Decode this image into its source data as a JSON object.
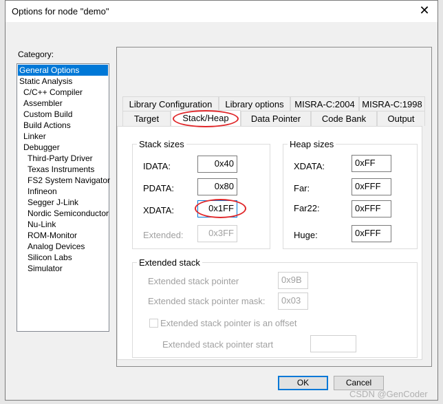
{
  "window": {
    "title": "Options for node \"demo\"",
    "close_icon": "close-icon"
  },
  "category": {
    "label": "Category:",
    "items": [
      {
        "label": "General Options",
        "indent": false,
        "selected": true
      },
      {
        "label": "Static Analysis",
        "indent": false
      },
      {
        "label": "C/C++ Compiler",
        "indent": true
      },
      {
        "label": "Assembler",
        "indent": true
      },
      {
        "label": "Custom Build",
        "indent": true
      },
      {
        "label": "Build Actions",
        "indent": true
      },
      {
        "label": "Linker",
        "indent": true
      },
      {
        "label": "Debugger",
        "indent": true
      },
      {
        "label": "Third-Party Driver",
        "indent": 2
      },
      {
        "label": "Texas Instruments",
        "indent": 2
      },
      {
        "label": "FS2 System Navigator",
        "indent": 2
      },
      {
        "label": "Infineon",
        "indent": 2
      },
      {
        "label": "Segger J-Link",
        "indent": 2
      },
      {
        "label": "Nordic Semiconductor",
        "indent": 2
      },
      {
        "label": "Nu-Link",
        "indent": 2
      },
      {
        "label": "ROM-Monitor",
        "indent": 2
      },
      {
        "label": "Analog Devices",
        "indent": 2
      },
      {
        "label": "Silicon Labs",
        "indent": 2
      },
      {
        "label": "Simulator",
        "indent": 2
      }
    ]
  },
  "tabs": {
    "row1": [
      "Library Configuration",
      "Library options",
      "MISRA-C:2004",
      "MISRA-C:1998"
    ],
    "row2": [
      "Target",
      "Stack/Heap",
      "Data Pointer",
      "Code Bank",
      "Output"
    ],
    "selected": "Stack/Heap"
  },
  "stack": {
    "title": "Stack sizes",
    "rows": [
      {
        "label": "IDATA:",
        "value": "0x40"
      },
      {
        "label": "PDATA:",
        "value": "0x80"
      },
      {
        "label": "XDATA:",
        "value": "0x1FF"
      },
      {
        "label": "Extended:",
        "value": "0x3FF",
        "disabled": true
      }
    ]
  },
  "heap": {
    "title": "Heap sizes",
    "rows": [
      {
        "label": "XDATA:",
        "value": "0xFF"
      },
      {
        "label": "Far:",
        "value": "0xFFF"
      },
      {
        "label": "Far22:",
        "value": "0xFFF"
      },
      {
        "label": "Huge:",
        "value": "0xFFF"
      }
    ]
  },
  "extended": {
    "title": "Extended stack",
    "pointer_label": "Extended stack pointer",
    "pointer_value": "0x9B",
    "mask_label": "Extended stack pointer mask:",
    "mask_value": "0x03",
    "offset_label": "Extended stack pointer is an offset",
    "offset_checked": false,
    "start_label": "Extended stack pointer start",
    "start_value": ""
  },
  "buttons": {
    "ok": "OK",
    "cancel": "Cancel"
  },
  "annotation_color": "#e0272a",
  "watermark": "CSDN @GenCoder"
}
